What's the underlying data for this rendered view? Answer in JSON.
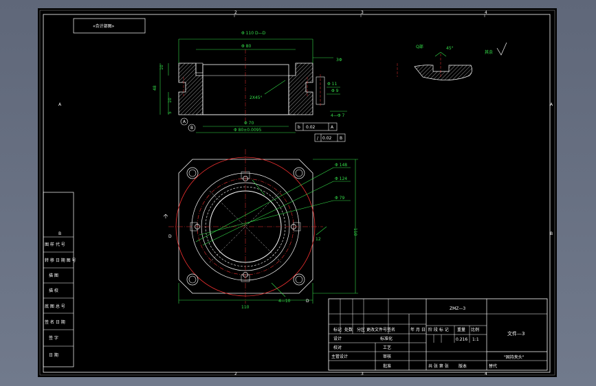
{
  "frame": {
    "zone_numbers_top": [
      "2",
      "3",
      "4"
    ],
    "zone_numbers_bottom": [
      "2",
      "3",
      "4"
    ],
    "zone_letters_left": [
      "A",
      "B"
    ],
    "zone_letters_right": [
      "A",
      "B"
    ]
  },
  "corner_label": "«合计部图»",
  "section_view": {
    "section_label": "D—D",
    "dim_outer_top": "Φ 110",
    "dim_top": "Φ 80",
    "dim_bore": "Φ 70",
    "dim_base": "Φ 80±0.0095",
    "dim_chamfer": "2X45°",
    "dim_h1": "10",
    "dim_h2": "48",
    "dim_h3": "10",
    "dim_h4": "5",
    "dim_small1": "Φ 11",
    "dim_small2": "Φ 9",
    "dim_holes": "4—Φ 7",
    "leader_label": "3Φ",
    "datum_a": "A",
    "datum_b": "B",
    "tol1": {
      "sym": "b",
      "value": "0.02",
      "datum": "A"
    },
    "tol2": {
      "sym": "/",
      "value": "0.02",
      "datum": "B"
    }
  },
  "detail_view": {
    "label": "Q部",
    "dim": "45°",
    "roughness": "其余"
  },
  "plan_view": {
    "dim_148": "Φ 148",
    "dim_124": "Φ 124",
    "dim_79": "Φ 79",
    "dim_height": "110",
    "dim_width": "110",
    "dim_slot": "4—10",
    "dim_12": "12",
    "section_letter_left": "D",
    "section_letter_right": "D"
  },
  "left_column": {
    "cells": [
      "图 样 代 号",
      "转 移 日 期 图 号",
      "描 图",
      "描 校",
      "底 图 总 号",
      "签 名 日 期",
      "签 字",
      "日 期"
    ]
  },
  "title_block": {
    "drawing_no": "ZMZ—3",
    "part_name": "文件—3",
    "material_name": "\"固持夹头\"",
    "mass": "0.216",
    "scale": "1:1",
    "headers": {
      "mark": "标记",
      "count": "处数",
      "zone": "分区",
      "doc": "更改文件号签名",
      "date": "年 月 日"
    },
    "stage_label": "阶 段 标 记",
    "mass_label": "重量",
    "scale_label": "比例",
    "rows_left": [
      "设计",
      "校对",
      "主管设计"
    ],
    "rows_mid": [
      "标准化",
      "工艺",
      "审核",
      "批准"
    ],
    "sheets_label": "共 张 第 张",
    "sheet_ref": "版本",
    "replace_label": "替代"
  }
}
